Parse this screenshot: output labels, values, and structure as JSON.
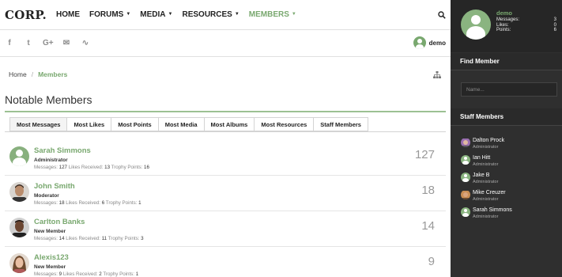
{
  "header": {
    "logo": "CORP.",
    "nav": [
      {
        "label": "HOME",
        "has_caret": false,
        "active": false
      },
      {
        "label": "FORUMS",
        "has_caret": true,
        "active": false
      },
      {
        "label": "MEDIA",
        "has_caret": true,
        "active": false
      },
      {
        "label": "RESOURCES",
        "has_caret": true,
        "active": false
      },
      {
        "label": "MEMBERS",
        "has_caret": true,
        "active": true
      }
    ],
    "search_icon": "search-icon"
  },
  "social": {
    "icons": [
      "facebook-icon",
      "twitter-icon",
      "google-plus-icon",
      "email-icon",
      "rss-icon"
    ],
    "glyphs": [
      "f",
      "t",
      "G+",
      "✉",
      "∿"
    ],
    "user": "demo"
  },
  "breadcrumb": {
    "home": "Home",
    "separator": "/",
    "current": "Members"
  },
  "page_title": "Notable Members",
  "tabs": [
    {
      "label": "Most Messages",
      "active": true
    },
    {
      "label": "Most Likes",
      "active": false
    },
    {
      "label": "Most Points",
      "active": false
    },
    {
      "label": "Most Media",
      "active": false
    },
    {
      "label": "Most Albums",
      "active": false
    },
    {
      "label": "Most Resources",
      "active": false
    },
    {
      "label": "Staff Members",
      "active": false
    }
  ],
  "stat_labels": {
    "messages": "Messages:",
    "likes": "Likes Received:",
    "points": "Trophy Points:"
  },
  "members": [
    {
      "name": "Sarah Simmons",
      "role": "Administrator",
      "messages": "127",
      "likes": "13",
      "points": "16",
      "count": "127",
      "avatar": "default"
    },
    {
      "name": "John Smith",
      "role": "Moderator",
      "messages": "18",
      "likes": "6",
      "points": "1",
      "count": "18",
      "avatar": "photo"
    },
    {
      "name": "Carlton Banks",
      "role": "New Member",
      "messages": "14",
      "likes": "11",
      "points": "3",
      "count": "14",
      "avatar": "photo"
    },
    {
      "name": "Alexis123",
      "role": "New Member",
      "messages": "9",
      "likes": "2",
      "points": "1",
      "count": "9",
      "avatar": "photo"
    }
  ],
  "sidebar": {
    "profile": {
      "username": "demo",
      "stats": [
        {
          "label": "Messages:",
          "value": "3"
        },
        {
          "label": "Likes:",
          "value": "0"
        },
        {
          "label": "Points:",
          "value": "6"
        }
      ]
    },
    "find_member": {
      "heading": "Find Member",
      "placeholder": "Name..."
    },
    "staff_heading": "Staff Members",
    "staff": [
      {
        "name": "Dalton Prock",
        "role": "Administrator",
        "avatar": "photo"
      },
      {
        "name": "Ian Hitt",
        "role": "Administrator",
        "avatar": "default"
      },
      {
        "name": "Jake B",
        "role": "Administrator",
        "avatar": "default"
      },
      {
        "name": "Mike Creuzer",
        "role": "Administrator",
        "avatar": "photo"
      },
      {
        "name": "Sarah Simmons",
        "role": "Administrator",
        "avatar": "default"
      }
    ]
  },
  "colors": {
    "accent": "#79a86f",
    "sidebar_bg": "#2f2f2f"
  }
}
